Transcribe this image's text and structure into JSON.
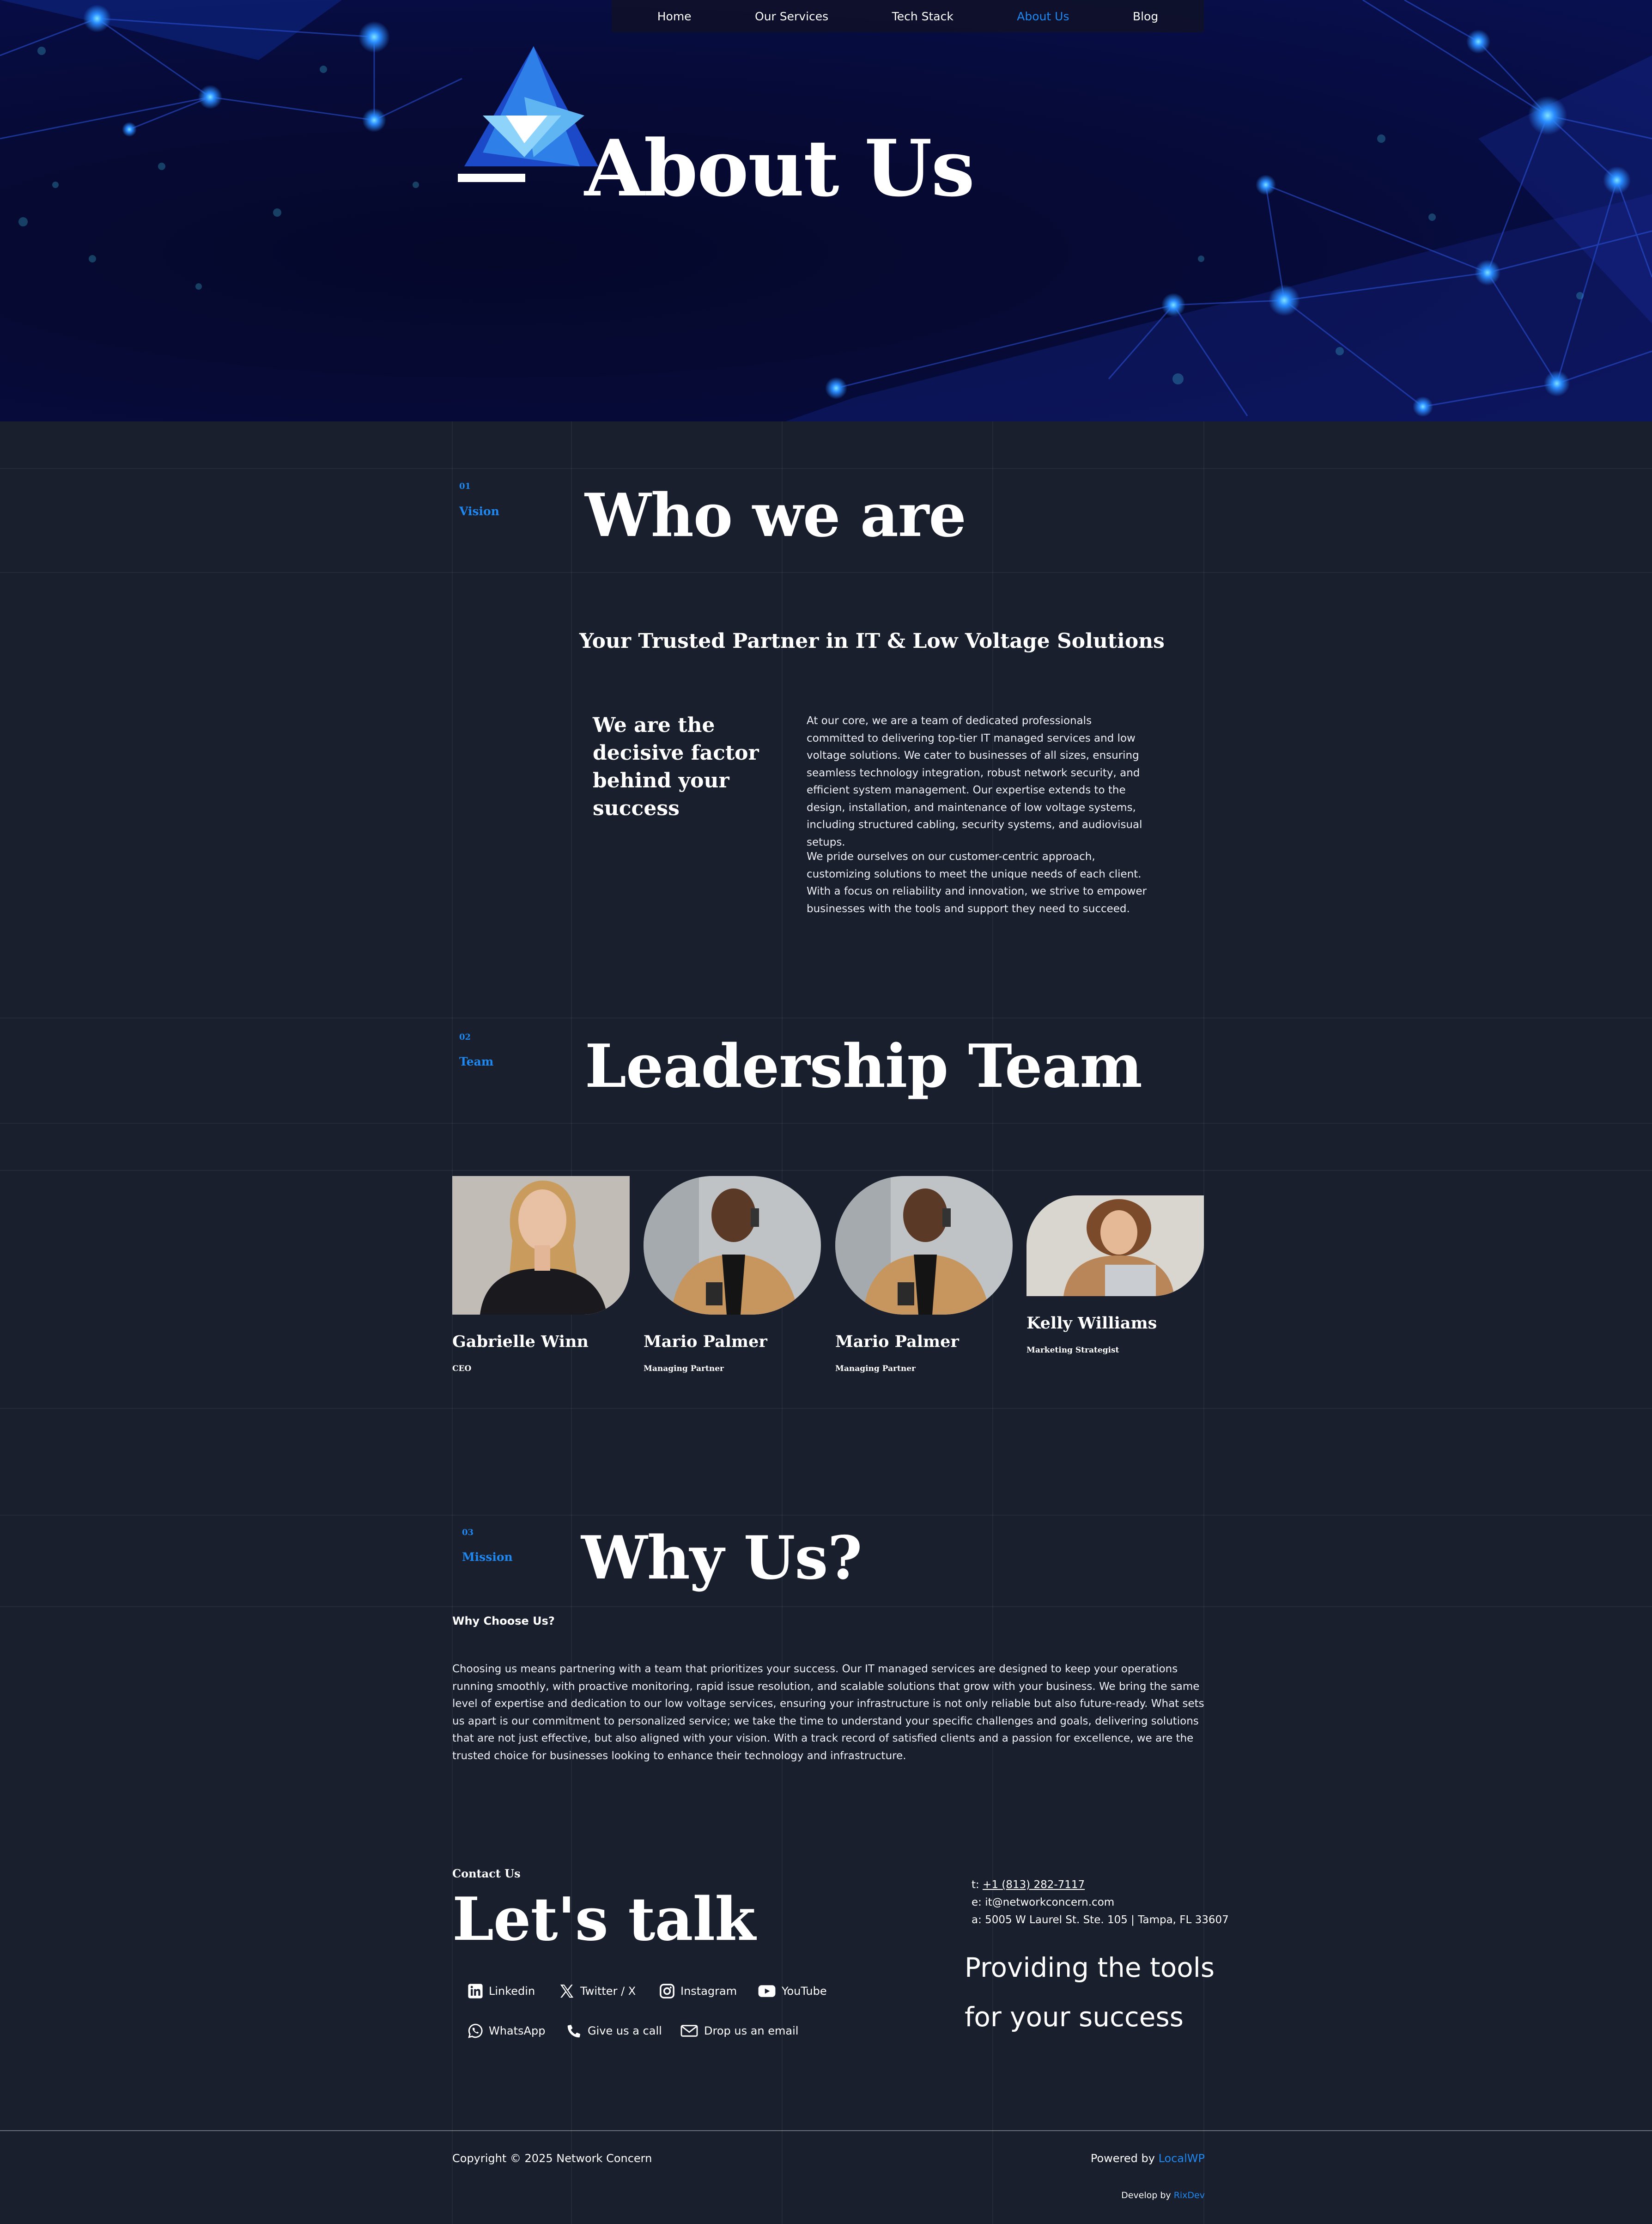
{
  "nav": {
    "items": [
      {
        "label": "Home"
      },
      {
        "label": "Our Services"
      },
      {
        "label": "Tech Stack"
      },
      {
        "label": "About Us"
      },
      {
        "label": "Blog"
      }
    ],
    "active_index": 3
  },
  "hero": {
    "title": "About Us"
  },
  "vision": {
    "number": "01",
    "label": "Vision",
    "title": "Who we are",
    "subheading": "Your Trusted Partner in IT & Low Voltage Solutions",
    "decisive": "We are the decisive factor behind your success",
    "paragraph1": "At our core, we are a team of dedicated professionals committed to delivering top-tier IT managed services and low voltage solutions. We cater to businesses of all sizes, ensuring seamless technology integration, robust network security, and efficient system management. Our expertise extends to the design, installation, and maintenance of low voltage systems, including structured cabling, security systems, and audiovisual setups.",
    "paragraph2": "We pride ourselves on our customer-centric approach, customizing solutions to meet the unique needs of each client. With a focus on reliability and innovation, we strive to empower businesses with the tools and support they need to succeed."
  },
  "team": {
    "number": "02",
    "label": "Team",
    "title": "Leadership Team",
    "members": [
      {
        "name": "Gabrielle Winn",
        "role": "CEO"
      },
      {
        "name": "Mario Palmer",
        "role": "Managing Partner"
      },
      {
        "name": "Mario Palmer",
        "role": "Managing Partner"
      },
      {
        "name": "Kelly Williams",
        "role": "Marketing Strategist"
      }
    ]
  },
  "mission": {
    "number": "03",
    "label": "Mission",
    "title": "Why Us?",
    "subheading": "Why Choose Us?",
    "paragraph": "Choosing us means partnering with a team that prioritizes your success. Our IT managed services are designed to keep your operations running smoothly, with proactive monitoring, rapid issue resolution, and scalable solutions that grow with your business. We bring the same level of expertise and dedication to our low voltage services, ensuring your infrastructure is not only reliable but also future-ready. What sets us apart is our commitment to personalized service; we take the time to understand your specific challenges and goals, delivering solutions that are not just effective, but also aligned with your vision. With a track record of satisfied clients and a passion for excellence, we are the trusted choice for businesses looking to enhance their technology and infrastructure."
  },
  "contact": {
    "small_label": "Contact Us",
    "title": "Let's talk",
    "socials": [
      {
        "label": "Linkedin",
        "icon": "linkedin-icon"
      },
      {
        "label": "Twitter / X",
        "icon": "x-icon"
      },
      {
        "label": "Instagram",
        "icon": "instagram-icon"
      },
      {
        "label": "YouTube",
        "icon": "youtube-icon"
      },
      {
        "label": "WhatsApp",
        "icon": "whatsapp-icon"
      },
      {
        "label": "Give us a call",
        "icon": "phone-icon"
      },
      {
        "label": "Drop us an email",
        "icon": "email-icon"
      }
    ],
    "phone_prefix": "t: ",
    "phone": "+1 (813) 282-7117",
    "email_line": "e: it@networkconcern.com",
    "address_line": "a: 5005 W Laurel St. Ste. 105 | Tampa, FL 33607",
    "tagline": "Providing the tools for your success"
  },
  "footer": {
    "copyright": "Copyright © 2025 Network Concern",
    "powered_prefix": "Powered by ",
    "powered_link": "LocalWP",
    "developed_prefix": "Develop by ",
    "developed_link": "RixDev"
  },
  "colors": {
    "background": "#1a1f2e",
    "accent": "#1e88f0",
    "hero": "#060a36"
  }
}
